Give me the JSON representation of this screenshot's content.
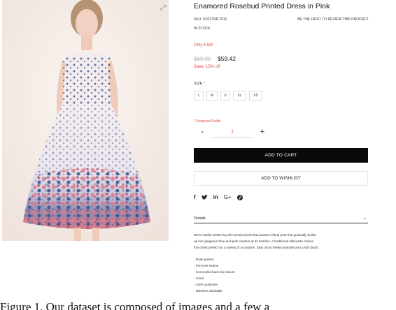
{
  "product": {
    "title": "Enamored Rosebud Printed Dress in Pink",
    "sku": "SKU: D20170417010",
    "review_link": "BE THE FIRST TO REVIEW THIS PRODUCT",
    "stock": "IN STOCK",
    "only_left": "Only 5 left",
    "old_price": "$69.90",
    "new_price": "$59.42",
    "save": "Save: 15% off",
    "size_label": "SIZE",
    "size_required_mark": "*",
    "sizes": [
      "L",
      "M",
      "S",
      "XL",
      "XS"
    ],
    "required_fields": "* Required Fields",
    "quantity": "1",
    "minus": "-",
    "plus": "+",
    "add_to_cart": "ADD TO CART",
    "add_to_wishlist": "ADD TO WISHLIST"
  },
  "social": {
    "facebook": "f",
    "twitter": "t",
    "linkedin": "in",
    "googleplus": "G+",
    "pinterest": "P"
  },
  "details": {
    "label": "Details",
    "chevron": "⌄",
    "description": [
      "We're totally smitten by this printed dress that boasts a floral print that gradually builds",
      "up into gorgeous blue-and-pink clusters at its hemline. A traditional silhouette makes",
      "this dress perfect for a variety of occasions. Step out in heeled sandals and a fab clutch."
    ],
    "features": [
      "- Rose pattern",
      "- Princess seams",
      "- Concealed back zip closure",
      "- Lined",
      "- 100% polyester",
      "- Machine washable"
    ]
  },
  "caption": "Figure 1.  Our dataset is composed of images and a few a",
  "colors": {
    "accent_red": "#e0453b",
    "button_black": "#0a0a0a",
    "photo_bg": "#f5ede7"
  },
  "icons": {
    "zoom": "expand-icon"
  }
}
